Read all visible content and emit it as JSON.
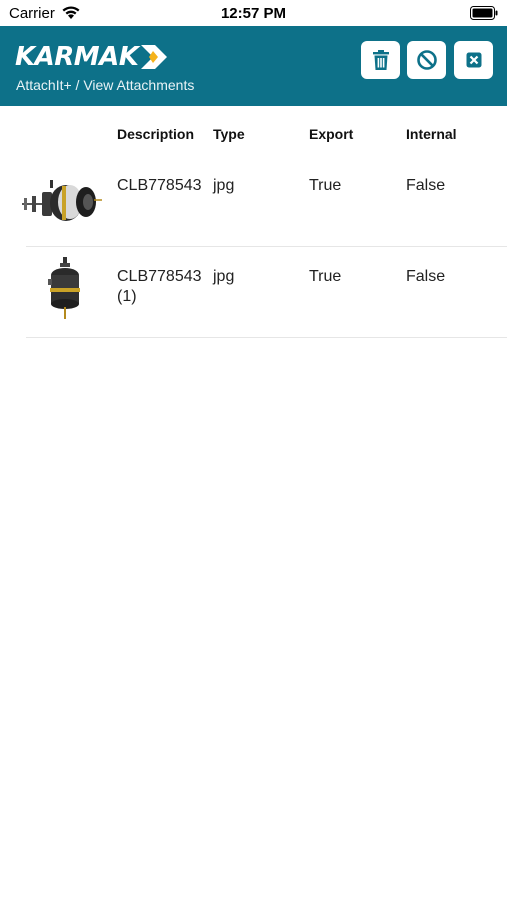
{
  "status_bar": {
    "carrier": "Carrier",
    "time": "12:57 PM"
  },
  "header": {
    "logo_text": "KARMAK",
    "breadcrumb": "AttachIt+ / View Attachments",
    "background_color": "#0d7189",
    "buttons": [
      {
        "icon": "trash-icon",
        "action": "delete"
      },
      {
        "icon": "cancel-icon",
        "action": "cancel"
      },
      {
        "icon": "close-icon",
        "action": "close"
      }
    ]
  },
  "table": {
    "columns": [
      "Description",
      "Type",
      "Export",
      "Internal"
    ],
    "rows": [
      {
        "description": "CLB778543",
        "type": "jpg",
        "export": "True",
        "internal": "False",
        "thumbnail": "brake-chamber-side-icon"
      },
      {
        "description": "CLB778543 (1)",
        "type": "jpg",
        "export": "True",
        "internal": "False",
        "thumbnail": "brake-chamber-upright-icon"
      }
    ]
  }
}
